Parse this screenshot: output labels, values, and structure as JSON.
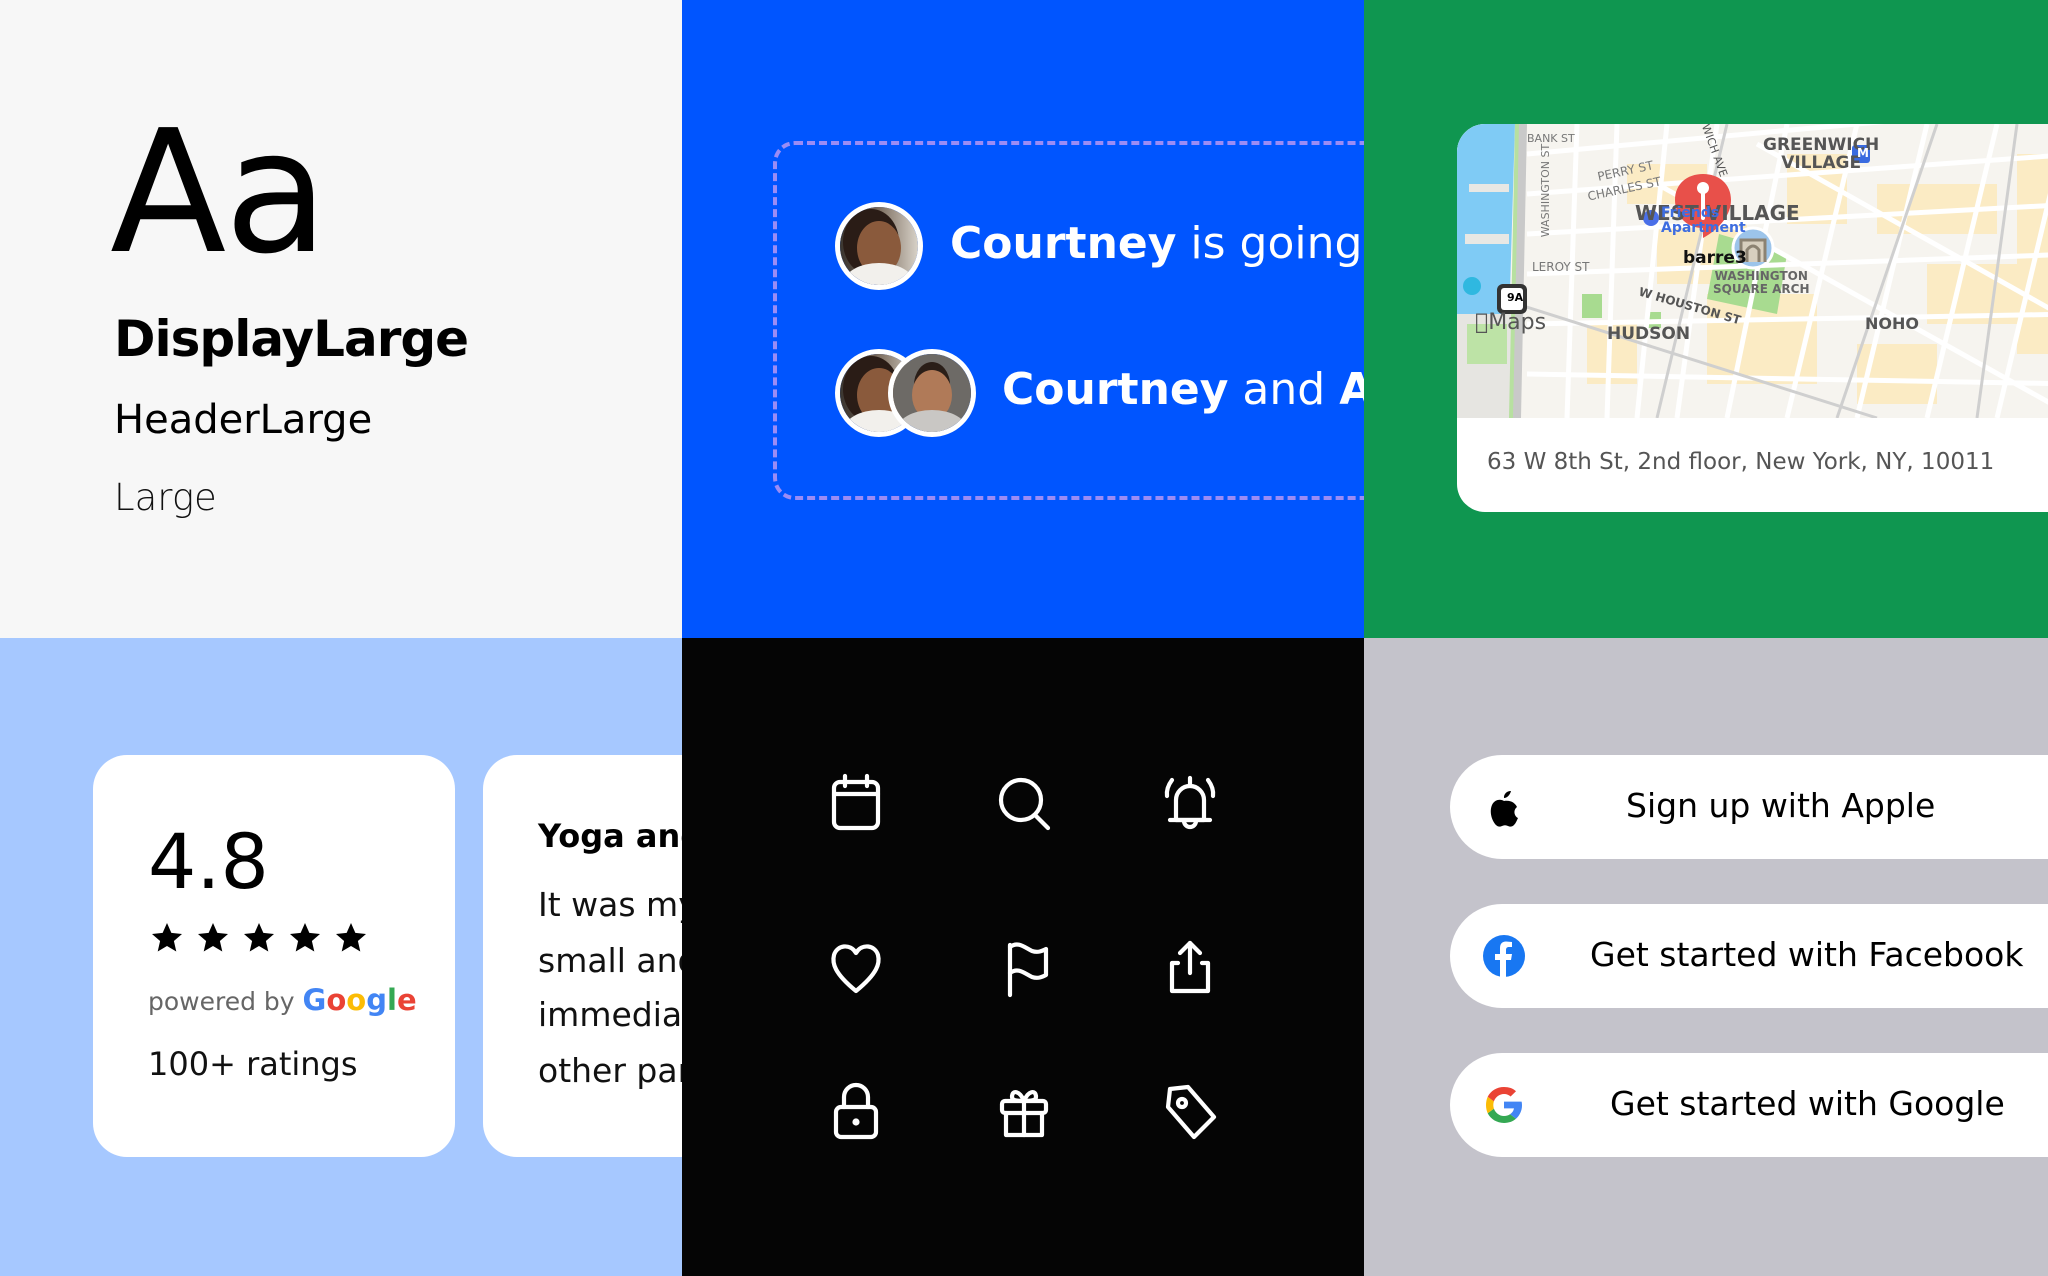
{
  "typography": {
    "sample": "Aa",
    "styles": [
      "DisplayLarge",
      "HeaderLarge",
      "Large"
    ]
  },
  "attendance": {
    "rows": [
      {
        "name": "Courtney",
        "rest": " is going",
        "avatars": [
          "courtney"
        ]
      },
      {
        "name": "Courtney",
        "rest": " and ",
        "name2": "An",
        "avatars": [
          "courtney",
          "andre"
        ]
      }
    ]
  },
  "map": {
    "labels": {
      "greenwich_village_1": "GREENWICH",
      "greenwich_village_2": "VILLAGE",
      "west_village": "WEST VILLAGE",
      "friends_1": "Friends",
      "friends_2": "Apartment",
      "pin": "barre3",
      "arch_1": "WASHINGTON",
      "arch_2": "SQUARE ARCH",
      "perry": "PERRY ST",
      "charles": "CHARLES ST",
      "bank": "BANK ST",
      "washington_st": "WASHINGTON ST",
      "leroy": "LEROY ST",
      "houston": "W HOUSTON ST",
      "hudson": "HUDSON",
      "noho": "NOHO",
      "ave": "WICH AVE",
      "route": "9A",
      "metro": "M",
      "attribution": "Maps"
    },
    "address": "63 W 8th St, 2nd floor, New York, NY, 10011"
  },
  "rating": {
    "value": "4.8",
    "stars": 5,
    "stars_max": 5,
    "powered_by": "powered by",
    "google_letters": [
      "G",
      "o",
      "o",
      "g",
      "l",
      "e"
    ],
    "google_colors": [
      "#4285F4",
      "#EA4335",
      "#FBBC05",
      "#4285F4",
      "#34A853",
      "#EA4335"
    ],
    "count": "100+ ratings"
  },
  "review": {
    "title": "Yoga and",
    "lines": [
      "It was my",
      "small and",
      "immediat",
      "other par"
    ]
  },
  "icons": [
    "calendar-icon",
    "search-icon",
    "bell-ringing-icon",
    "heart-icon",
    "flag-icon",
    "share-icon",
    "lock-icon",
    "gift-icon",
    "tag-icon"
  ],
  "social": {
    "buttons": [
      {
        "label": "Sign up with Apple",
        "icon": "apple-icon"
      },
      {
        "label": "Get started with Facebook",
        "icon": "facebook-icon",
        "color": "#1877F2"
      },
      {
        "label": "Get started with Google",
        "icon": "google-icon"
      }
    ]
  },
  "colors": {
    "type_bg": "#F7F7F7",
    "avatar_bg": "#0055FF",
    "map_bg": "#0F9650",
    "rating_bg": "#A6C8FF",
    "icons_bg": "#050505",
    "social_bg": "#C4C3CB",
    "dash": "#9B8CF5",
    "pin": "#E8504A"
  }
}
